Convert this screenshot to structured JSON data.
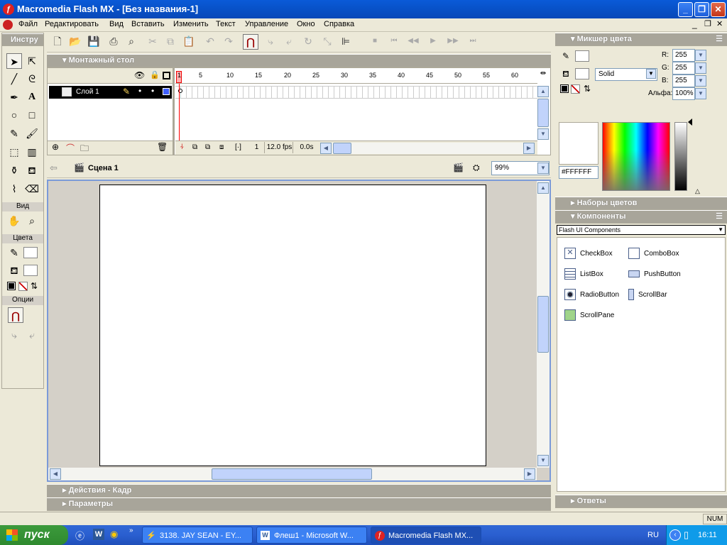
{
  "window": {
    "title": "Macromedia Flash MX - [Без названия-1]",
    "controls": [
      "_",
      "❐",
      "✕"
    ]
  },
  "menu": {
    "items": [
      "Файл",
      "Редактировать",
      "Вид",
      "Вставить",
      "Изменить",
      "Текст",
      "Управление",
      "Окно",
      "Справка"
    ]
  },
  "tools": {
    "title": "Инстру",
    "view_label": "Вид",
    "colors_label": "Цвета",
    "options_label": "Опции"
  },
  "timeline": {
    "title": "Монтажный стол",
    "layer_name": "Слой 1",
    "ticks": [
      "1",
      "5",
      "10",
      "15",
      "20",
      "25",
      "30",
      "35",
      "40",
      "45",
      "50",
      "55",
      "60"
    ],
    "current_frame": "1",
    "fps": "12.0 fps",
    "elapsed": "0.0s"
  },
  "edit_bar": {
    "scene": "Сцена 1",
    "zoom": "99%"
  },
  "bottom_panels": {
    "actions": "Действия - Кадр",
    "params": "Параметры"
  },
  "color_mixer": {
    "title": "Микшер цвета",
    "fill_style": "Solid",
    "r_label": "R:",
    "g_label": "G:",
    "b_label": "B:",
    "alpha_label": "Альфа:",
    "r": "255",
    "g": "255",
    "b": "255",
    "alpha": "100%",
    "hex": "#FFFFFF"
  },
  "swatches": {
    "title": "Наборы цветов"
  },
  "components": {
    "title": "Компоненты",
    "set": "Flash UI Components",
    "items": [
      "CheckBox",
      "ComboBox",
      "ListBox",
      "PushButton",
      "RadioButton",
      "ScrollBar",
      "ScrollPane"
    ]
  },
  "answers": {
    "title": "Ответы"
  },
  "status": {
    "num": "NUM"
  },
  "taskbar": {
    "start": "пуск",
    "tasks": [
      "3138. JAY SEAN - EY...",
      "Флеш1 - Microsoft W...",
      "Macromedia Flash MX..."
    ],
    "lang": "RU",
    "clock": "16:11"
  },
  "colors": {
    "accent": "#0a5ad8",
    "stage_bg": "#ffffff",
    "work_bg": "#d4d0c8",
    "playhead": "#ff0000"
  }
}
